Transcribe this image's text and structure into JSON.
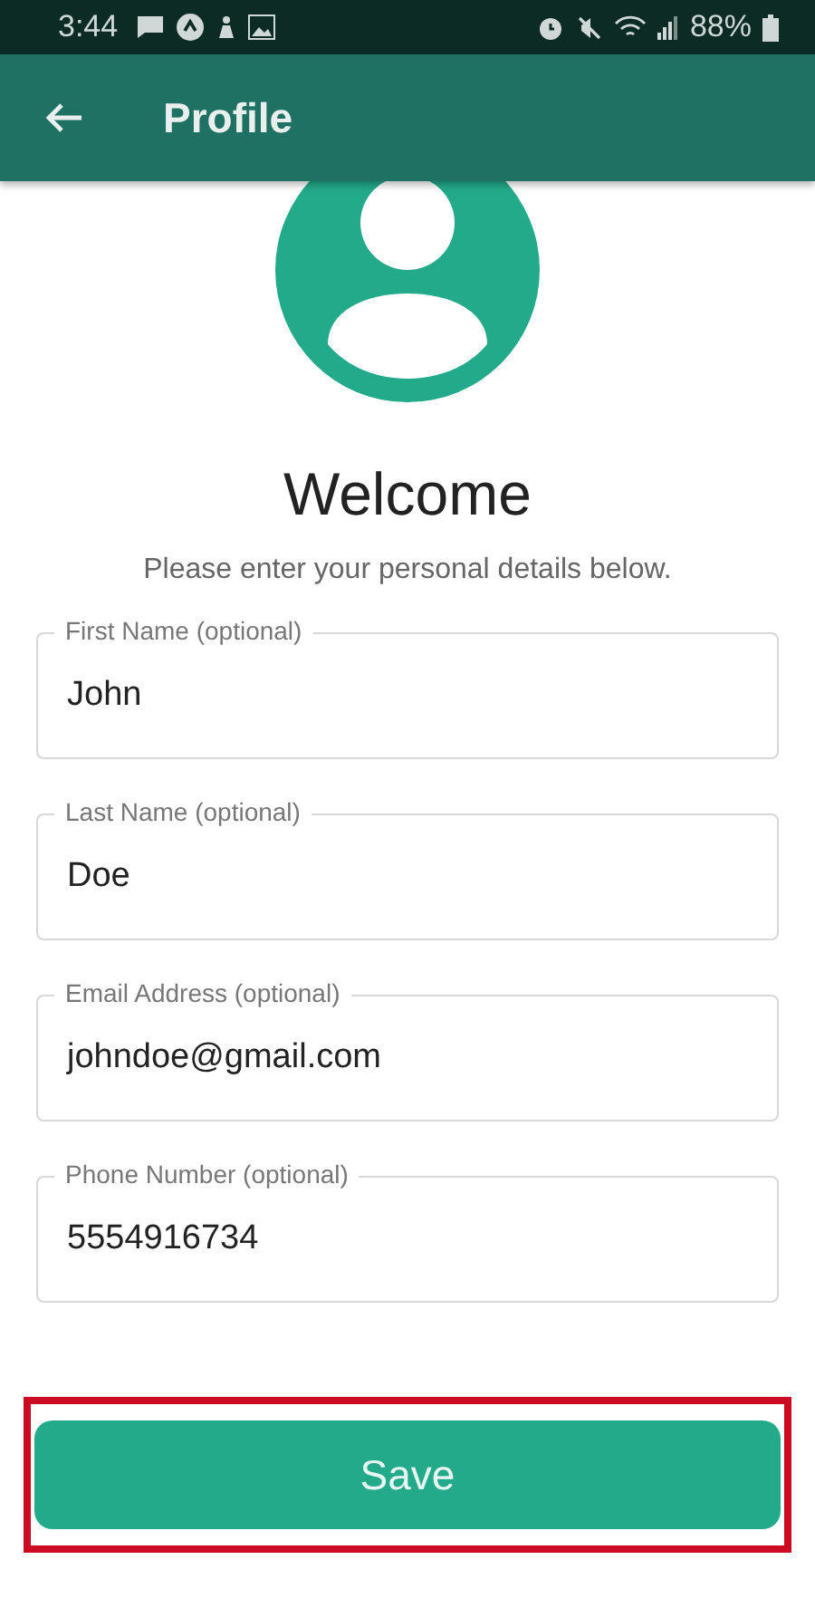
{
  "status_bar": {
    "time": "3:44",
    "battery": "88%"
  },
  "app_bar": {
    "title": "Profile"
  },
  "heading": "Welcome",
  "subtitle": "Please enter your personal details below.",
  "fields": [
    {
      "label": "First Name (optional)",
      "value": "John"
    },
    {
      "label": "Last Name (optional)",
      "value": "Doe"
    },
    {
      "label": "Email Address (optional)",
      "value": "johndoe@gmail.com"
    },
    {
      "label": "Phone Number (optional)",
      "value": "5554916734"
    }
  ],
  "save_button": {
    "label": "Save",
    "highlighted": true
  }
}
